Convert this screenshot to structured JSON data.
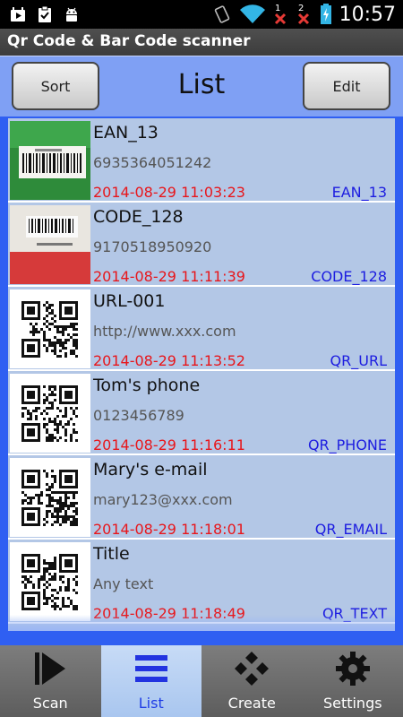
{
  "status_bar": {
    "time": "10:57",
    "icons": [
      "youtube-icon",
      "clipboard-check-icon",
      "android-icon",
      "vibrate-icon",
      "wifi-icon",
      "signal-1-icon",
      "signal-2-icon",
      "battery-charging-icon"
    ],
    "sim_labels": [
      "1",
      "2"
    ]
  },
  "app": {
    "title": "Qr Code & Bar Code scanner"
  },
  "header": {
    "sort_label": "Sort",
    "title": "List",
    "edit_label": "Edit"
  },
  "list": {
    "items": [
      {
        "name": "EAN_13",
        "value": "6935364051242",
        "datetime": "2014-08-29 11:03:23",
        "type": "EAN_13",
        "thumb": "barcode-photo-green"
      },
      {
        "name": "CODE_128",
        "value": "9170518950920",
        "datetime": "2014-08-29 11:11:39",
        "type": "CODE_128",
        "thumb": "barcode-photo-red"
      },
      {
        "name": "URL-001",
        "value": "http://www.xxx.com",
        "datetime": "2014-08-29 11:13:52",
        "type": "QR_URL",
        "thumb": "qr-code"
      },
      {
        "name": "Tom's phone",
        "value": "0123456789",
        "datetime": "2014-08-29 11:16:11",
        "type": "QR_PHONE",
        "thumb": "qr-code"
      },
      {
        "name": "Mary's e-mail",
        "value": "mary123@xxx.com",
        "datetime": "2014-08-29 11:18:01",
        "type": "QR_EMAIL",
        "thumb": "qr-code"
      },
      {
        "name": "Title",
        "value": "Any text",
        "datetime": "2014-08-29 11:18:49",
        "type": "QR_TEXT",
        "thumb": "qr-code"
      }
    ]
  },
  "bottom_nav": {
    "active": "List",
    "tabs": [
      {
        "label": "Scan",
        "icon": "play-icon"
      },
      {
        "label": "List",
        "icon": "list-icon"
      },
      {
        "label": "Create",
        "icon": "diamond-grid-icon"
      },
      {
        "label": "Settings",
        "icon": "gear-icon"
      }
    ]
  },
  "colors": {
    "frame_blue": "#2f5ff2",
    "list_bg": "#b3c7e6",
    "date_red": "#e8161b",
    "type_blue": "#1c1ce0",
    "header_blue": "#7fa0f4",
    "active_tab_label": "#1f3de6"
  }
}
